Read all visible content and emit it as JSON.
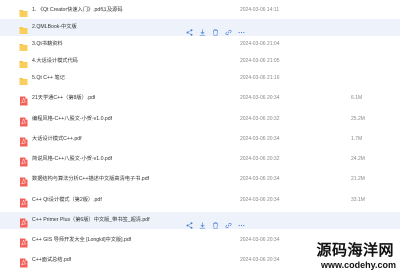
{
  "files": [
    {
      "icon": "folder-icon",
      "name": "1. 《Qt Creator快速入门》.pdf以及源码",
      "date": "2024-03-06 14:11",
      "size": "",
      "highlight": false
    },
    {
      "icon": "folder-icon",
      "name": "2.QMLBook-中文版",
      "date": "",
      "size": "",
      "highlight": true
    },
    {
      "icon": "folder-icon",
      "name": "3.Qt书籍资料",
      "date": "2024-03-06 21:04",
      "size": "",
      "highlight": false
    },
    {
      "icon": "folder-icon",
      "name": "4.大话设计模式代码",
      "date": "2024-03-06 21:05",
      "size": "",
      "highlight": false
    },
    {
      "icon": "folder-icon",
      "name": "5.Qt C++ 笔记",
      "date": "2024-03-06 21:16",
      "size": "",
      "highlight": false
    },
    {
      "icon": "pdf-icon",
      "name": "21天学通C++（第8版）.pdf",
      "date": "2024-03-06 20:34",
      "size": "6.1M",
      "highlight": false
    },
    {
      "icon": "pdf-icon",
      "name": "编程风格-C++八股文-小贺-v1.0.pdf",
      "date": "2024-03-06 20:32",
      "size": "25.2M",
      "highlight": false
    },
    {
      "icon": "pdf-icon",
      "name": "大话设计模式C++.pdf",
      "date": "2024-03-06 20:34",
      "size": "1.7M",
      "highlight": false
    },
    {
      "icon": "pdf-icon",
      "name": "简说风格-C++八股文-小贺-v1.0.pdf",
      "date": "2024-03-06 20:32",
      "size": "24.2M",
      "highlight": false
    },
    {
      "icon": "pdf-icon",
      "name": "数据结构与算法分析C++描述中文版高清电子书.pdf",
      "date": "2024-03-06 20:34",
      "size": "21.2M",
      "highlight": false
    },
    {
      "icon": "pdf-icon",
      "name": "C++ Qt设计模式（第2版）.pdf",
      "date": "2024-03-06 20:34",
      "size": "33.1M",
      "highlight": false
    },
    {
      "icon": "pdf-icon",
      "name": "C++ Primer Plus（第6版）中文版_带书签_超清.pdf",
      "date": "",
      "size": "",
      "highlight": true
    },
    {
      "icon": "pdf-icon",
      "name": "C++ GIS 导师开发大全 [Longkil]中文版].pdf",
      "date": "2024-03-06 20:34",
      "size": "",
      "highlight": false
    },
    {
      "icon": "pdf-icon",
      "name": "C++面试总结.pdf",
      "date": "2024-03-06 20:34",
      "size": "",
      "highlight": false
    }
  ],
  "row_actions": [
    "share-icon",
    "download-icon",
    "delete-icon",
    "link-icon",
    "more-icon"
  ],
  "colors": {
    "folder": "#f5c242",
    "pdf": "#f4615b",
    "action": "#4a7fd8",
    "highlight": "#eef3fb"
  },
  "watermark": {
    "title": "源码海洋网",
    "url": "www.codehy.com"
  }
}
